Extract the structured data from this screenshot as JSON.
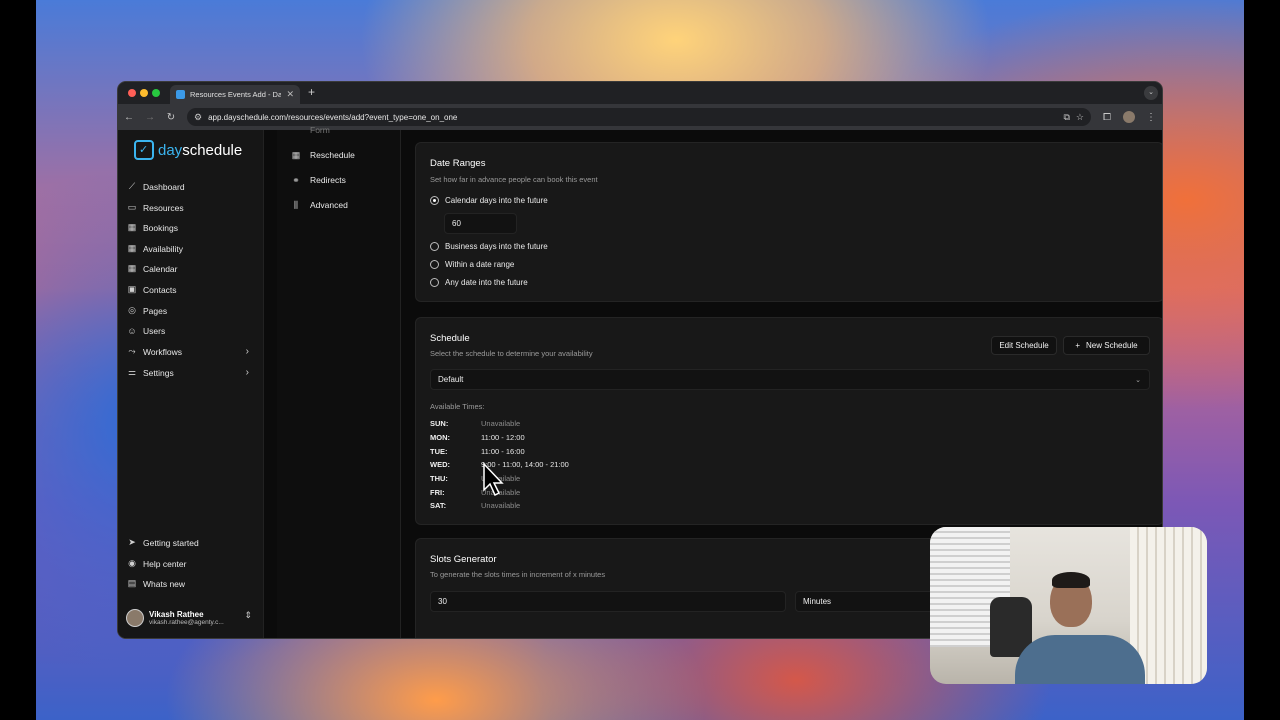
{
  "browser": {
    "tab_title": "Resources Events Add - DaySchedule",
    "url": "app.dayschedule.com/resources/events/add?event_type=one_on_one"
  },
  "app": {
    "logo_prefix": "day",
    "logo_suffix": "schedule"
  },
  "sidebar": {
    "items": [
      {
        "label": "Dashboard",
        "icon": "chart-icon"
      },
      {
        "label": "Resources",
        "icon": "folder-icon"
      },
      {
        "label": "Bookings",
        "icon": "calendar-check-icon"
      },
      {
        "label": "Availability",
        "icon": "calendar-icon"
      },
      {
        "label": "Calendar",
        "icon": "calendar-icon"
      },
      {
        "label": "Contacts",
        "icon": "contact-icon"
      },
      {
        "label": "Pages",
        "icon": "globe-icon"
      },
      {
        "label": "Users",
        "icon": "users-icon"
      },
      {
        "label": "Workflows",
        "icon": "workflow-icon"
      },
      {
        "label": "Settings",
        "icon": "sliders-icon"
      }
    ],
    "bottom_items": [
      {
        "label": "Getting started",
        "icon": "send-icon"
      },
      {
        "label": "Help center",
        "icon": "help-icon"
      },
      {
        "label": "Whats new",
        "icon": "gift-icon"
      }
    ],
    "user": {
      "name": "Vikash Rathee",
      "email": "vikash.rathee@agenty.c..."
    }
  },
  "subnav": {
    "partial_top": "Form",
    "items": [
      {
        "label": "Reschedule",
        "icon": "calendar-icon"
      },
      {
        "label": "Redirects",
        "icon": "link-icon"
      },
      {
        "label": "Advanced",
        "icon": "sliders-icon"
      }
    ]
  },
  "date_ranges": {
    "title": "Date Ranges",
    "subtitle": "Set how far in advance people can book this event",
    "options": [
      {
        "label": "Calendar days into the future",
        "selected": true
      },
      {
        "label": "Business days into the future",
        "selected": false
      },
      {
        "label": "Within a date range",
        "selected": false
      },
      {
        "label": "Any date into the future",
        "selected": false
      }
    ],
    "days_value": "60"
  },
  "schedule": {
    "title": "Schedule",
    "subtitle": "Select the schedule to determine your availability",
    "edit_button": "Edit Schedule",
    "new_button": "New Schedule",
    "selected": "Default",
    "available_label": "Available Times:",
    "days": [
      {
        "day": "SUN:",
        "times": "Unavailable",
        "available": false
      },
      {
        "day": "MON:",
        "times": "11:00 - 12:00",
        "available": true
      },
      {
        "day": "TUE:",
        "times": "11:00 - 16:00",
        "available": true
      },
      {
        "day": "WED:",
        "times": "9:00 - 11:00, 14:00 - 21:00",
        "available": true
      },
      {
        "day": "THU:",
        "times": "Unavailable",
        "available": false
      },
      {
        "day": "FRI:",
        "times": "Unavailable",
        "available": false
      },
      {
        "day": "SAT:",
        "times": "Unavailable",
        "available": false
      }
    ]
  },
  "slots": {
    "title": "Slots Generator",
    "subtitle": "To generate the slots times in increment of x minutes",
    "value": "30",
    "unit": "Minutes"
  }
}
